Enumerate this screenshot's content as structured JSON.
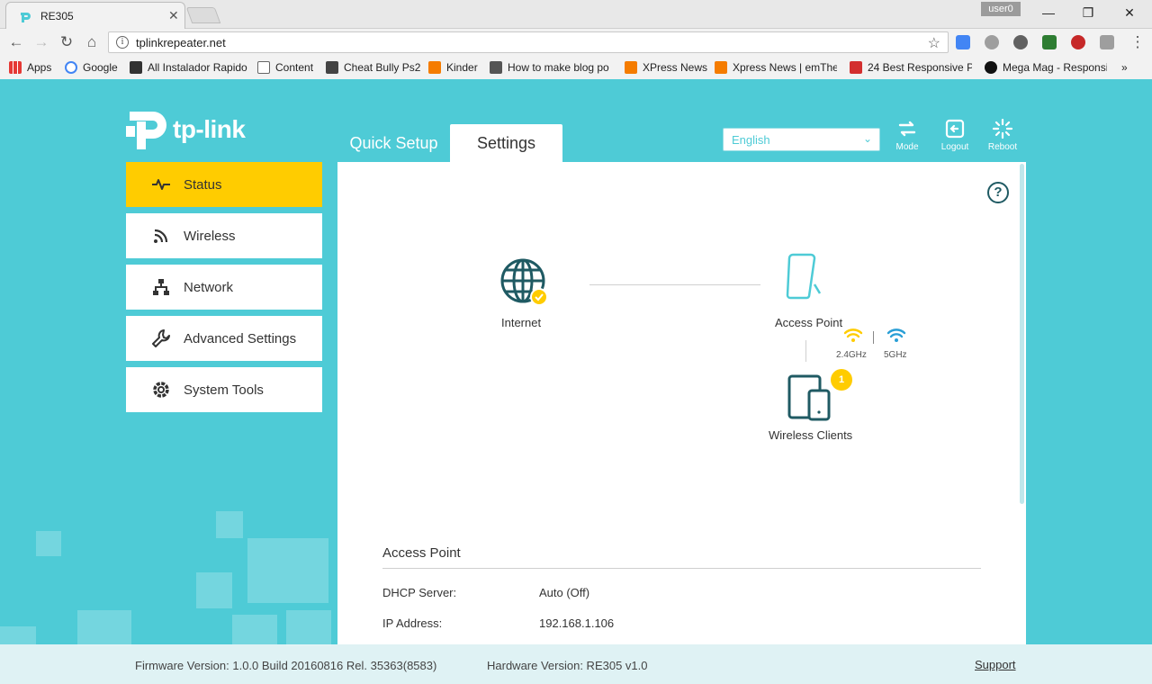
{
  "browser": {
    "tab_title": "RE305",
    "tab_close": "✕",
    "user": "user0",
    "url": "tplinkrepeater.net",
    "window_controls": {
      "minimize": "—",
      "maximize": "❐",
      "close": "✕"
    },
    "nav": {
      "back": "←",
      "forward": "→",
      "reload": "↻",
      "home": "⌂"
    },
    "info": "i",
    "star": "☆",
    "menu": "⋮",
    "more_bookmarks": "»",
    "bookmarks": [
      {
        "label": "Apps",
        "icon": "apps-grid-icon"
      },
      {
        "label": "Google",
        "icon": "google-icon"
      },
      {
        "label": "All Instalador Rapido",
        "icon": "instalador-icon"
      },
      {
        "label": "Content",
        "icon": "page-icon"
      },
      {
        "label": "Cheat Bully Ps2",
        "icon": "gamepad-icon"
      },
      {
        "label": "Kinder",
        "icon": "blogger-icon"
      },
      {
        "label": "How to make blog po",
        "icon": "hash-icon"
      },
      {
        "label": "XPress News",
        "icon": "blogger-icon"
      },
      {
        "label": "Xpress News | emThe",
        "icon": "blogger-icon"
      },
      {
        "label": "24 Best Responsive P",
        "icon": "mag-icon"
      },
      {
        "label": "Mega Mag - Responsi",
        "icon": "j-icon"
      }
    ]
  },
  "header": {
    "logo_text": "tp-link",
    "tabs": [
      {
        "label": "Quick Setup",
        "active": false
      },
      {
        "label": "Settings",
        "active": true
      }
    ],
    "language": {
      "selected": "English",
      "chevron": "⌄"
    },
    "actions": [
      {
        "label": "Mode",
        "icon": "mode-icon"
      },
      {
        "label": "Logout",
        "icon": "logout-icon"
      },
      {
        "label": "Reboot",
        "icon": "reboot-icon"
      }
    ]
  },
  "sidebar": {
    "items": [
      {
        "label": "Status",
        "icon": "pulse-icon",
        "active": true
      },
      {
        "label": "Wireless",
        "icon": "wireless-icon",
        "active": false
      },
      {
        "label": "Network",
        "icon": "network-icon",
        "active": false
      },
      {
        "label": "Advanced Settings",
        "icon": "wrench-icon",
        "active": false
      },
      {
        "label": "System Tools",
        "icon": "gear-icon",
        "active": false
      }
    ]
  },
  "status": {
    "help": "?",
    "internet_label": "Internet",
    "access_point_label": "Access Point",
    "band_24": "2.4GHz",
    "band_5": "5GHz",
    "wireless_clients_label": "Wireless Clients",
    "wireless_clients_count": "1",
    "section_title": "Access Point",
    "rows": [
      {
        "label": "DHCP Server:",
        "value": "Auto (Off)"
      },
      {
        "label": "IP Address:",
        "value": "192.168.1.106"
      }
    ]
  },
  "footer": {
    "firmware": "Firmware Version: 1.0.0 Build 20160816 Rel. 35363(8583)",
    "hardware": "Hardware Version: RE305 v1.0",
    "support": "Support"
  },
  "colors": {
    "brand_teal": "#4ecbd6",
    "active_yellow": "#ffcc00",
    "icon_dark": "#1f5a63"
  }
}
